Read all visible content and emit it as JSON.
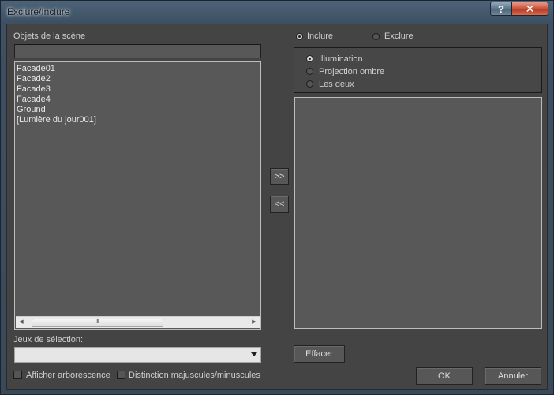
{
  "window": {
    "title": "Exclure/Inclure",
    "help_label": "?",
    "close_label": "✕"
  },
  "left": {
    "objects_label": "Objets de la scène",
    "search_value": "",
    "scene_objects": [
      "Facade01",
      "Facade2",
      "Facade3",
      "Facade4",
      "Ground",
      "[Lumière du jour001]"
    ],
    "scroll_left": "◀",
    "scroll_right": "▶",
    "scroll_grip": "III",
    "selection_sets_label": "Jeux de sélection:",
    "selection_sets_value": "",
    "show_tree_label": "Afficher arborescence",
    "case_sensitive_label": "Distinction majuscules/minuscules"
  },
  "middle": {
    "add_label": ">>",
    "remove_label": "<<"
  },
  "right": {
    "include_label": "Inclure",
    "exclude_label": "Exclure",
    "mode_selected": "Inclure",
    "options": [
      "Illumination",
      "Projection ombre",
      "Les deux"
    ],
    "option_selected": "Illumination",
    "selected_objects": [],
    "clear_label": "Effacer"
  },
  "footer": {
    "ok_label": "OK",
    "cancel_label": "Annuler"
  }
}
